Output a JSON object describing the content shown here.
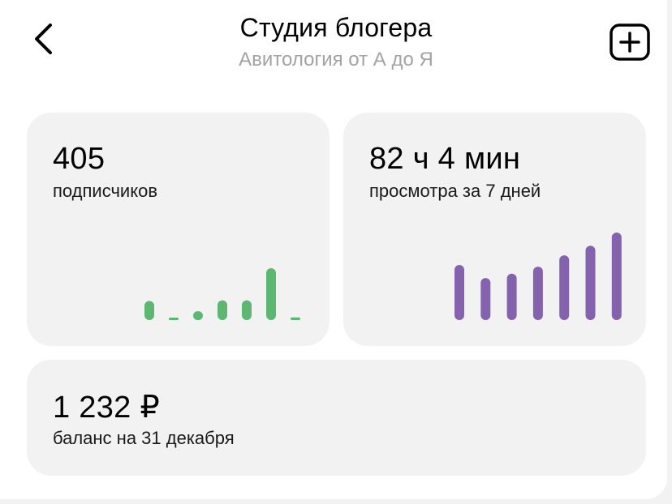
{
  "header": {
    "title": "Студия блогера",
    "subtitle": "Авитология от А до Я",
    "back_icon": "chevron-left-icon",
    "add_icon": "plus-square-icon"
  },
  "subscribers": {
    "value": "405",
    "label": "подписчиков",
    "bar_color": "#5db672",
    "bar_levels": [
      0.37,
      0.04,
      0.17,
      0.38,
      0.38,
      1.0,
      0.05
    ]
  },
  "views": {
    "value": "82 ч 4 мин",
    "label": "просмотра за 7 дней",
    "bar_color": "#8462ae",
    "bar_levels": [
      0.63,
      0.48,
      0.53,
      0.61,
      0.74,
      0.85,
      1.0
    ]
  },
  "balance": {
    "value": "1 232 ₽",
    "label": "баланс на 31 декабря"
  }
}
